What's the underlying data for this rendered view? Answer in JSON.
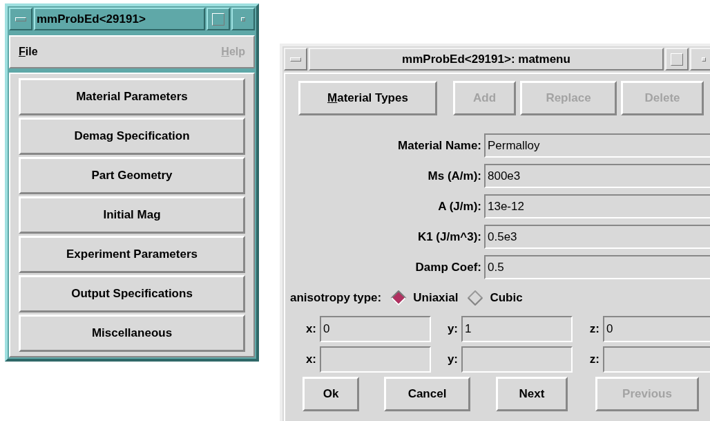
{
  "main_window": {
    "title": "mmProbEd<29191>",
    "active": true,
    "menu": [
      {
        "label": "File",
        "underline_first": true,
        "disabled": false
      },
      {
        "label": "Help",
        "underline_first": true,
        "disabled": true
      }
    ],
    "buttons": [
      {
        "label": "Material Parameters"
      },
      {
        "label": "Demag Specification"
      },
      {
        "label": "Part Geometry"
      },
      {
        "label": "Initial Mag"
      },
      {
        "label": "Experiment Parameters"
      },
      {
        "label": "Output Specifications"
      },
      {
        "label": "Miscellaneous"
      }
    ]
  },
  "dialog": {
    "title": "mmProbEd<29191>: matmenu",
    "active": false,
    "toolbar": [
      {
        "label": "Material Types",
        "underline_first": true,
        "disabled": false
      },
      {
        "label": "Add",
        "underline_first": false,
        "disabled": true
      },
      {
        "label": "Replace",
        "underline_first": false,
        "disabled": true
      },
      {
        "label": "Delete",
        "underline_first": false,
        "disabled": true
      }
    ],
    "fields": [
      {
        "label": "Material Name:",
        "value": "Permalloy"
      },
      {
        "label": "Ms (A/m):",
        "value": "800e3"
      },
      {
        "label": "A (J/m):",
        "value": "13e-12"
      },
      {
        "label": "K1 (J/m^3):",
        "value": "0.5e3"
      },
      {
        "label": "Damp Coef:",
        "value": "0.5"
      }
    ],
    "anisotropy": {
      "label": "anisotropy type:",
      "options": [
        {
          "label": "Uniaxial",
          "selected": true
        },
        {
          "label": "Cubic",
          "selected": false
        }
      ]
    },
    "axes": [
      [
        {
          "label": "x:",
          "value": "0"
        },
        {
          "label": "y:",
          "value": "1"
        },
        {
          "label": "z:",
          "value": "0"
        }
      ],
      [
        {
          "label": "x:"
        },
        {
          "label": "y:"
        },
        {
          "label": "z:"
        }
      ]
    ],
    "buttons": [
      {
        "label": "Ok",
        "disabled": false
      },
      {
        "label": "Cancel",
        "disabled": false
      },
      {
        "label": "Next",
        "disabled": false
      },
      {
        "label": "Previous",
        "disabled": true
      }
    ]
  }
}
